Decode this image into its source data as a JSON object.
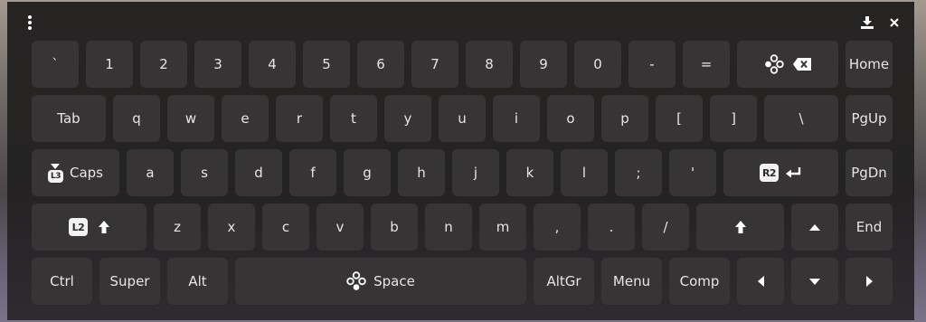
{
  "toolbar": {
    "menu_icon": "vertical-dots-icon",
    "download_icon": "download-icon",
    "close_icon": "close-icon"
  },
  "rows": {
    "row1": {
      "backtick": "`",
      "k1": "1",
      "k2": "2",
      "k3": "3",
      "k4": "4",
      "k5": "5",
      "k6": "6",
      "k7": "7",
      "k8": "8",
      "k9": "9",
      "k0": "0",
      "minus": "-",
      "equals": "=",
      "home": "Home"
    },
    "row2": {
      "tab": "Tab",
      "q": "q",
      "w": "w",
      "e": "e",
      "r": "r",
      "t": "t",
      "y": "y",
      "u": "u",
      "i": "i",
      "o": "o",
      "p": "p",
      "lbracket": "[",
      "rbracket": "]",
      "backslash": "\\",
      "pgup": "PgUp"
    },
    "row3": {
      "caps": "Caps",
      "caps_badge": "L3",
      "a": "a",
      "s": "s",
      "d": "d",
      "f": "f",
      "g": "g",
      "h": "h",
      "j": "j",
      "k": "k",
      "l": "l",
      "semicolon": ";",
      "quote": "'",
      "enter_badge": "R2",
      "pgdn": "PgDn"
    },
    "row4": {
      "shift_badge": "L2",
      "z": "z",
      "x": "x",
      "c": "c",
      "v": "v",
      "b": "b",
      "n": "n",
      "m": "m",
      "comma": ",",
      "period": ".",
      "slash": "/",
      "end": "End"
    },
    "row5": {
      "ctrl": "Ctrl",
      "super": "Super",
      "alt": "Alt",
      "space": "Space",
      "altgr": "AltGr",
      "menu": "Menu",
      "comp": "Comp"
    }
  },
  "colors": {
    "key_bg": "#363434",
    "text": "#e6e6e6",
    "badge_bg": "#f2f2f2"
  }
}
